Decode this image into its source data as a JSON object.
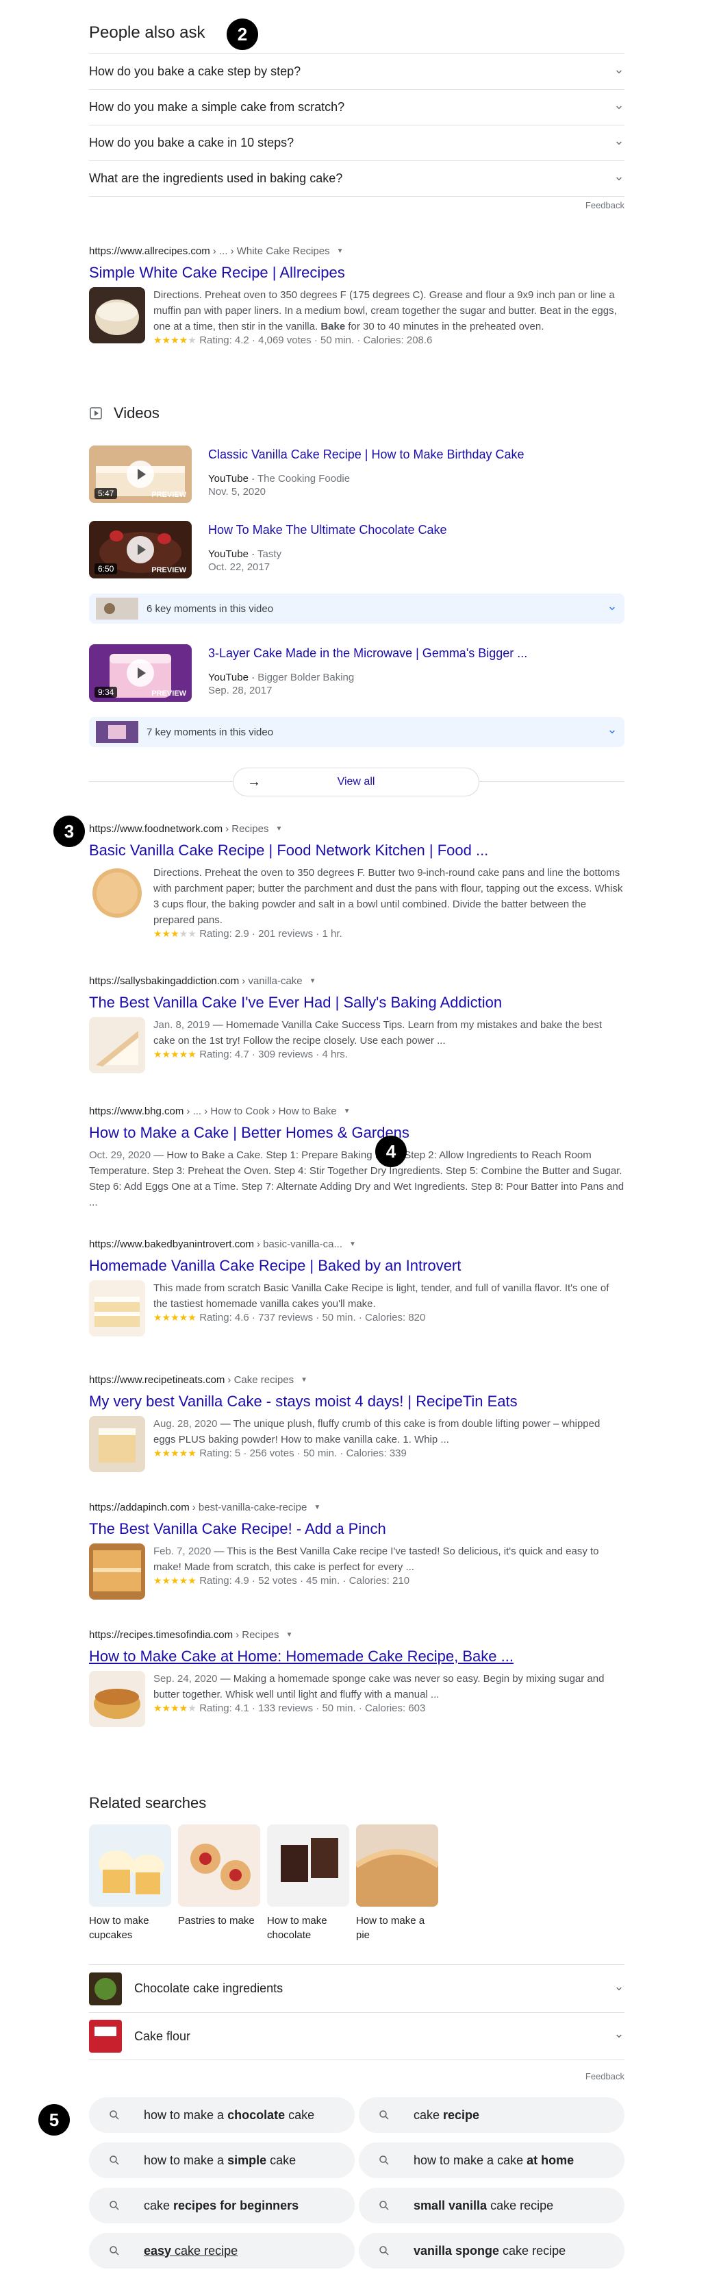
{
  "paa": {
    "title": "People also ask",
    "questions": [
      "How do you bake a cake step by step?",
      "How do you make a simple cake from scratch?",
      "How do you bake a cake in 10 steps?",
      "What are the ingredients used in baking cake?"
    ],
    "feedback": "Feedback"
  },
  "markers": [
    "2",
    "3",
    "4",
    "5"
  ],
  "allrecipes": {
    "site": "https://www.allrecipes.com",
    "path": " › ... › White Cake Recipes",
    "title": "Simple White Cake Recipe | Allrecipes",
    "snippet_a": "Directions. Preheat oven to 350 degrees F (175 degrees C). Grease and flour a 9x9 inch pan or line a muffin pan with paper liners. In a medium bowl, cream together the sugar and butter. Beat in the eggs, one at a time, then stir in the vanilla. ",
    "snippet_b": "Bake",
    "snippet_c": " for 30 to 40 minutes in the preheated oven.",
    "rating": "Rating: 4.2 · 4,069 votes · 50 min. · Calories: 208.6",
    "stars": 4
  },
  "videos": {
    "heading": "Videos",
    "items": [
      {
        "title": "Classic Vanilla Cake Recipe | How to Make Birthday Cake",
        "source": "YouTube",
        "channel": "The Cooking Foodie",
        "date": "Nov. 5, 2020",
        "duration": "5:47",
        "preview": "PREVIEW"
      },
      {
        "title": "How To Make The Ultimate Chocolate Cake",
        "source": "YouTube",
        "channel": "Tasty",
        "date": "Oct. 22, 2017",
        "duration": "6:50",
        "preview": "PREVIEW"
      },
      {
        "title": "3-Layer Cake Made in the Microwave | Gemma's Bigger ...",
        "source": "YouTube",
        "channel": "Bigger Bolder Baking",
        "date": "Sep. 28, 2017",
        "duration": "9:34",
        "preview": "PREVIEW"
      }
    ],
    "key_moments_1": "6 key moments in this video",
    "key_moments_2": "7 key moments in this video",
    "view_all": "View all"
  },
  "results": [
    {
      "site": "https://www.foodnetwork.com",
      "path": " › Recipes",
      "title": "Basic Vanilla Cake Recipe | Food Network Kitchen | Food ...",
      "snippet": "Directions. Preheat the oven to 350 degrees F. Butter two 9-inch-round cake pans and line the bottoms with parchment paper; butter the parchment and dust the pans with flour, tapping out the excess. Whisk 3 cups flour, the baking powder and salt in a bowl until combined. Divide the batter between the prepared pans.",
      "rating": "Rating: 2.9 · 201 reviews · 1 hr.",
      "stars": 3
    },
    {
      "site": "https://sallysbakingaddiction.com",
      "path": " › vanilla-cake",
      "title": "The Best Vanilla Cake I've Ever Had | Sally's Baking Addiction",
      "date": "Jan. 8, 2019",
      "snippet": " — Homemade Vanilla Cake Success Tips. Learn from my mistakes and bake the best cake on the 1st try! Follow the recipe closely. Use each power ...",
      "rating": "Rating: 4.7 · 309 reviews · 4 hrs.",
      "stars": 5
    },
    {
      "site": "https://www.bhg.com",
      "path": " › ... › How to Cook › How to Bake",
      "title": "How to Make a Cake | Better Homes & Gardens",
      "date": "Oct. 29, 2020",
      "snippet": " — How to Bake a Cake. Step 1: Prepare Baking Pans. Step 2: Allow Ingredients to Reach Room Temperature. Step 3: Preheat the Oven. Step 4: Stir Together Dry Ingredients. Step 5: Combine the Butter and Sugar. Step 6: Add Eggs One at a Time. Step 7: Alternate Adding Dry and Wet Ingredients. Step 8: Pour Batter into Pans and ..."
    },
    {
      "site": "https://www.bakedbyanintrovert.com",
      "path": " › basic-vanilla-ca...",
      "title": "Homemade Vanilla Cake Recipe | Baked by an Introvert",
      "snippet": "This made from scratch Basic Vanilla Cake Recipe is light, tender, and full of vanilla flavor. It's one of the tastiest homemade vanilla cakes you'll make.",
      "rating": "Rating: 4.6 · 737 reviews · 50 min. · Calories: 820",
      "stars": 5
    },
    {
      "site": "https://www.recipetineats.com",
      "path": " › Cake recipes",
      "title": "My very best Vanilla Cake - stays moist 4 days! | RecipeTin Eats",
      "date": "Aug. 28, 2020",
      "snippet": " — The unique plush, fluffy crumb of this cake is from double lifting power – whipped eggs PLUS baking powder! How to make vanilla cake. 1. Whip ...",
      "rating": "Rating: 5 · 256 votes · 50 min. · Calories: 339",
      "stars": 5
    },
    {
      "site": "https://addapinch.com",
      "path": " › best-vanilla-cake-recipe",
      "title": "The Best Vanilla Cake Recipe! - Add a Pinch",
      "date": "Feb. 7, 2020",
      "snippet": " — This is the Best Vanilla Cake recipe I've tasted! So delicious, it's quick and easy to make! Made from scratch, this cake is perfect for every ...",
      "rating": "Rating: 4.9 · 52 votes · 45 min. · Calories: 210",
      "stars": 5
    },
    {
      "site": "https://recipes.timesofindia.com",
      "path": " › Recipes",
      "title": "How to Make Cake at Home: Homemade Cake Recipe, Bake ...",
      "date": "Sep. 24, 2020",
      "snippet": " — Making a homemade sponge cake was never so easy. Begin by mixing sugar and butter together. Whisk well until light and fluffy with a manual ...",
      "rating": "Rating: 4.1 · 133 reviews · 50 min. · Calories: 603",
      "stars": 4
    }
  ],
  "related": {
    "title": "Related searches",
    "cards": [
      "How to make cupcakes",
      "Pastries to make",
      "How to make chocolate",
      "How to make a pie"
    ],
    "rows": [
      "Chocolate cake ingredients",
      "Cake flour"
    ],
    "feedback": "Feedback"
  },
  "chips": [
    {
      "pre": "how to make a ",
      "bold": "chocolate",
      "post": " cake"
    },
    {
      "pre": "cake ",
      "bold": "recipe",
      "post": ""
    },
    {
      "pre": "how to make a ",
      "bold": "simple",
      "post": " cake"
    },
    {
      "pre": "how to make a cake ",
      "bold": "at home",
      "post": ""
    },
    {
      "pre": "cake ",
      "bold": "recipes for beginners",
      "post": ""
    },
    {
      "pre": "",
      "bold": "small vanilla",
      "post": " cake recipe"
    },
    {
      "pre": "",
      "bold": "easy",
      "post": " cake recipe"
    },
    {
      "pre": "",
      "bold": "vanilla sponge",
      "post": " cake recipe"
    }
  ],
  "colors": {
    "link": "#1a0dab",
    "star": "#fbbc04",
    "chip_bg": "#f1f3f4",
    "key_moments_bg": "#eef5fe"
  }
}
